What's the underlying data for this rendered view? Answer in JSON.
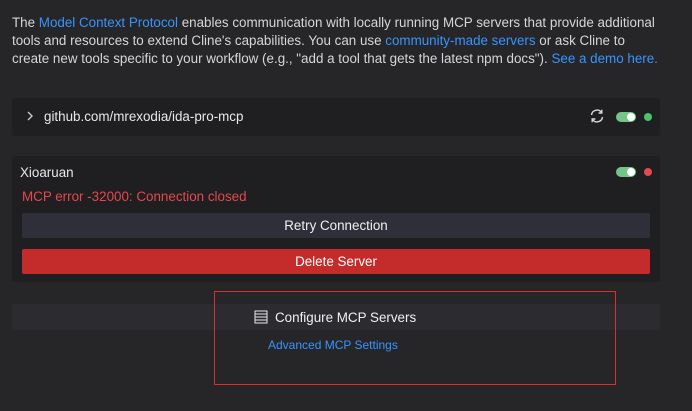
{
  "intro": {
    "text_1": "The ",
    "link_protocol": "Model Context Protocol",
    "text_2": " enables communication with locally running MCP servers that provide additional tools and resources to extend Cline's capabilities. You can use ",
    "link_community": "community-made servers",
    "text_3": " or ask Cline to create new tools specific to your workflow (e.g., \"add a tool that gets the latest npm docs\"). ",
    "link_demo": "See a demo here."
  },
  "servers": [
    {
      "name": "github.com/mrexodia/ida-pro-mcp",
      "enabled": true,
      "status": "connected",
      "status_color": "#4cc26a",
      "icons": [
        "chevron-right-icon",
        "refresh-icon"
      ]
    },
    {
      "name": "Xioaruan",
      "enabled": true,
      "status": "error",
      "status_color": "#e5484d",
      "error": "MCP error -32000: Connection closed",
      "retry_label": "Retry Connection",
      "delete_label": "Delete Server"
    }
  ],
  "footer": {
    "configure_label": "Configure MCP Servers",
    "configure_icon": "server-icon",
    "advanced_label": "Advanced MCP Settings"
  },
  "colors": {
    "link": "#3794ff",
    "error": "#e5484d",
    "danger_button": "#c42b2b",
    "toggle_on": "#74c48a",
    "highlight": "#d8302c"
  }
}
